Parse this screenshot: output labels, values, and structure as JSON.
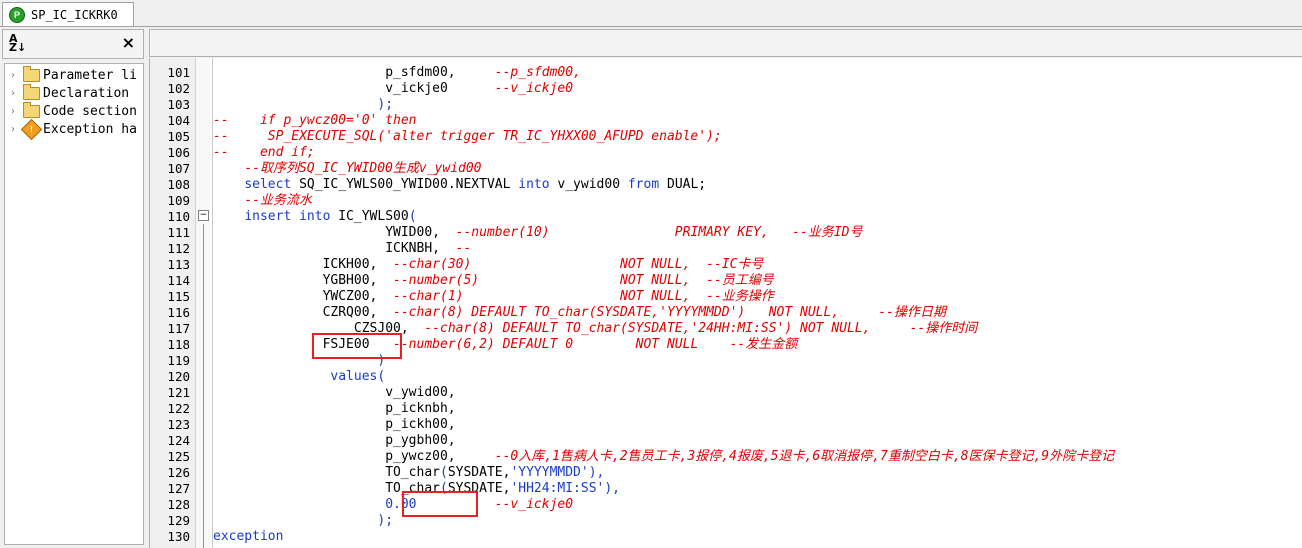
{
  "tab": {
    "title": "SP_IC_ICKRK0",
    "icon": "procedure-icon"
  },
  "left_panel": {
    "sort_label": "A Z",
    "close_label": "×",
    "tree": [
      {
        "label": "Parameter li",
        "icon": "folder-icon"
      },
      {
        "label": "Declaration",
        "icon": "folder-icon"
      },
      {
        "label": "Code section",
        "icon": "folder-icon"
      },
      {
        "label": "Exception ha",
        "icon": "exception-icon"
      }
    ]
  },
  "editor": {
    "lines": [
      {
        "n": "101",
        "indent": "                      ",
        "segs": [
          {
            "t": "tx",
            "v": "p_sfdm00,     "
          },
          {
            "t": "cm",
            "v": "--p_sfdm00,"
          }
        ]
      },
      {
        "n": "102",
        "indent": "                      ",
        "segs": [
          {
            "t": "tx",
            "v": "v_ickje0      "
          },
          {
            "t": "cm",
            "v": "--v_ickje0"
          }
        ]
      },
      {
        "n": "103",
        "indent": "                     ",
        "segs": [
          {
            "t": "pl",
            "v": ");"
          }
        ]
      },
      {
        "n": "104",
        "indent": "",
        "segs": [
          {
            "t": "cm",
            "v": "--    if p_ywcz00='0' then"
          }
        ]
      },
      {
        "n": "105",
        "indent": "",
        "segs": [
          {
            "t": "cm",
            "v": "--     SP_EXECUTE_SQL('alter trigger TR_IC_YHXX00_AFUPD enable');"
          }
        ]
      },
      {
        "n": "106",
        "indent": "",
        "segs": [
          {
            "t": "cm",
            "v": "--    end if;"
          }
        ]
      },
      {
        "n": "107",
        "indent": "    ",
        "segs": [
          {
            "t": "cm",
            "v": "--取序列SQ_IC_YWID00生成v_ywid00"
          }
        ]
      },
      {
        "n": "108",
        "indent": "    ",
        "segs": [
          {
            "t": "kw",
            "v": "select "
          },
          {
            "t": "tx",
            "v": "SQ_IC_YWLS00_YWID00.NEXTVAL "
          },
          {
            "t": "kw",
            "v": "into "
          },
          {
            "t": "tx",
            "v": "v_ywid00 "
          },
          {
            "t": "kw",
            "v": "from "
          },
          {
            "t": "tx",
            "v": "DUAL;"
          }
        ]
      },
      {
        "n": "109",
        "indent": "    ",
        "segs": [
          {
            "t": "cm",
            "v": "--业务流水"
          }
        ]
      },
      {
        "n": "110",
        "indent": "    ",
        "segs": [
          {
            "t": "kw",
            "v": "insert into "
          },
          {
            "t": "tx",
            "v": "IC_YWLS00"
          },
          {
            "t": "pl",
            "v": "("
          }
        ]
      },
      {
        "n": "111",
        "indent": "                      ",
        "segs": [
          {
            "t": "tx",
            "v": "YWID00,  "
          },
          {
            "t": "cm",
            "v": "--number(10)                PRIMARY KEY,   --业务ID号"
          }
        ]
      },
      {
        "n": "112",
        "indent": "                      ",
        "segs": [
          {
            "t": "tx",
            "v": "ICKNBH,  "
          },
          {
            "t": "cm",
            "v": "--"
          }
        ]
      },
      {
        "n": "113",
        "indent": "              ",
        "segs": [
          {
            "t": "tx",
            "v": "ICKH00,  "
          },
          {
            "t": "cm",
            "v": "--char(30)                   NOT NULL,  --IC卡号"
          }
        ]
      },
      {
        "n": "114",
        "indent": "              ",
        "segs": [
          {
            "t": "tx",
            "v": "YGBH00,  "
          },
          {
            "t": "cm",
            "v": "--number(5)                  NOT NULL,  --员工编号"
          }
        ]
      },
      {
        "n": "115",
        "indent": "              ",
        "segs": [
          {
            "t": "tx",
            "v": "YWCZ00,  "
          },
          {
            "t": "cm",
            "v": "--char(1)                    NOT NULL,  --业务操作"
          }
        ]
      },
      {
        "n": "116",
        "indent": "              ",
        "segs": [
          {
            "t": "tx",
            "v": "CZRQ00,  "
          },
          {
            "t": "cm",
            "v": "--char(8) DEFAULT TO_char(SYSDATE,'YYYYMMDD')   NOT NULL,     --操作日期"
          }
        ]
      },
      {
        "n": "117",
        "indent": "                  ",
        "segs": [
          {
            "t": "tx",
            "v": "CZSJ00,  "
          },
          {
            "t": "cm",
            "v": "--char(8) DEFAULT TO_char(SYSDATE,'24HH:MI:SS') NOT NULL,     --操作时间"
          }
        ]
      },
      {
        "n": "118",
        "indent": "              ",
        "segs": [
          {
            "t": "tx",
            "v": "FSJE00   "
          },
          {
            "t": "cm",
            "v": "--number(6,2) DEFAULT 0        NOT NULL    --发生金额"
          }
        ]
      },
      {
        "n": "119",
        "indent": "                     ",
        "segs": [
          {
            "t": "pl",
            "v": ")"
          }
        ]
      },
      {
        "n": "120",
        "indent": "               ",
        "segs": [
          {
            "t": "kw",
            "v": "values"
          },
          {
            "t": "pl",
            "v": "("
          }
        ]
      },
      {
        "n": "121",
        "indent": "                      ",
        "segs": [
          {
            "t": "tx",
            "v": "v_ywid00,"
          }
        ]
      },
      {
        "n": "122",
        "indent": "                      ",
        "segs": [
          {
            "t": "tx",
            "v": "p_icknbh,"
          }
        ]
      },
      {
        "n": "123",
        "indent": "                      ",
        "segs": [
          {
            "t": "tx",
            "v": "p_ickh00,"
          }
        ]
      },
      {
        "n": "124",
        "indent": "                      ",
        "segs": [
          {
            "t": "tx",
            "v": "p_ygbh00,"
          }
        ]
      },
      {
        "n": "125",
        "indent": "                      ",
        "segs": [
          {
            "t": "tx",
            "v": "p_ywcz00,     "
          },
          {
            "t": "cm",
            "v": "--0入库,1售病人卡,2售员工卡,3报停,4报废,5退卡,6取消报停,7重制空白卡,8医保卡登记,9外院卡登记"
          }
        ]
      },
      {
        "n": "126",
        "indent": "                      ",
        "segs": [
          {
            "t": "tx",
            "v": "TO_char"
          },
          {
            "t": "pl",
            "v": "("
          },
          {
            "t": "tx",
            "v": "SYSDATE,"
          },
          {
            "t": "st",
            "v": "'YYYYMMDD'"
          },
          {
            "t": "pl",
            "v": "),"
          }
        ]
      },
      {
        "n": "127",
        "indent": "                      ",
        "segs": [
          {
            "t": "tx",
            "v": "TO_char"
          },
          {
            "t": "pl",
            "v": "("
          },
          {
            "t": "tx",
            "v": "SYSDATE,"
          },
          {
            "t": "st",
            "v": "'HH24:MI:SS'"
          },
          {
            "t": "pl",
            "v": "),"
          }
        ]
      },
      {
        "n": "128",
        "indent": "                      ",
        "segs": [
          {
            "t": "st",
            "v": "0.00"
          },
          {
            "t": "tx",
            "v": "          "
          },
          {
            "t": "cm",
            "v": "--v_ickje0"
          }
        ]
      },
      {
        "n": "129",
        "indent": "                     ",
        "segs": [
          {
            "t": "pl",
            "v": ");"
          }
        ]
      },
      {
        "n": "130",
        "indent": "",
        "segs": [
          {
            "t": "kw",
            "v": "exception"
          }
        ]
      }
    ]
  },
  "colors": {
    "keyword": "#1a3cc8",
    "comment": "#e00000",
    "highlight_box": "#e82020"
  }
}
